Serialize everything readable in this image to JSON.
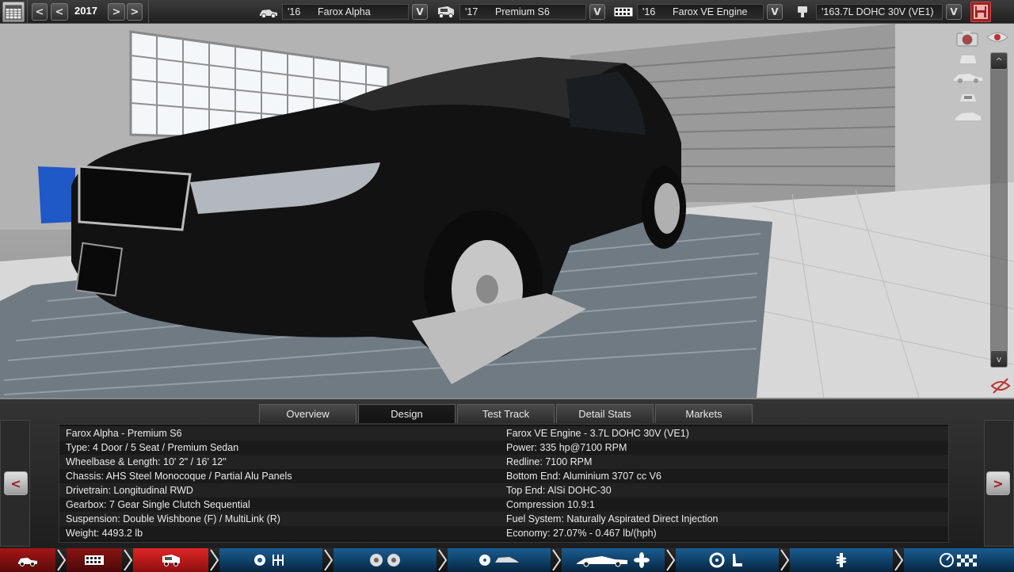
{
  "topbar": {
    "year": "2017",
    "prev_fast": "<",
    "prev": "<",
    "next": ">",
    "next_fast": ">",
    "model": {
      "year": "'16",
      "name": "Farox Alpha",
      "dropdown": "V"
    },
    "trim": {
      "year": "'17",
      "name": "Premium S6",
      "dropdown": "V"
    },
    "engine_family": {
      "year": "'16",
      "name": "Farox VE Engine",
      "dropdown": "V"
    },
    "engine_variant": {
      "name": "'163.7L DOHC 30V (VE1)",
      "dropdown": "V"
    }
  },
  "scene": {
    "scroll_up": "^",
    "scroll_down": "v"
  },
  "tabs": [
    "Overview",
    "Design",
    "Test Track",
    "Detail Stats",
    "Markets"
  ],
  "active_tab": "Design",
  "panel": {
    "prev": "<",
    "next": ">",
    "left_stats": [
      "Farox Alpha - Premium S6",
      "Type: 4 Door / 5 Seat / Premium Sedan",
      "Wheelbase & Length: 10' 2\" / 16' 12\"",
      "Chassis: AHS Steel Monocoque / Partial Alu Panels",
      "Drivetrain: Longitudinal RWD",
      "Gearbox: 7 Gear Single Clutch Sequential",
      "Suspension: Double Wishbone (F) / MultiLink (R)",
      "Weight: 4493.2 lb"
    ],
    "right_stats": [
      "Farox VE Engine - 3.7L DOHC 30V (VE1)",
      "Power: 335 hp@7100 RPM",
      "Redline: 7100 RPM",
      "Bottom End: Aluminium 3707 cc V6",
      "Top End: AlSi DOHC-30",
      "Compression 10.9:1",
      "Fuel System: Naturally Aspirated Direct Injection",
      "Economy: 27.07% - 0.467 lb/(hph)"
    ]
  },
  "nav_steps": [
    {
      "icon": "car-model-icon",
      "color": "#8a1010"
    },
    {
      "icon": "chassis-icon",
      "color": "#8a1010"
    },
    {
      "icon": "trim-icon",
      "color": "#c01a1a"
    },
    {
      "icon": "engine-gearbox-icon",
      "color": "#0d3c63"
    },
    {
      "icon": "wheels-icon",
      "color": "#0d3c63"
    },
    {
      "icon": "fixtures-icon",
      "color": "#0d3c63"
    },
    {
      "icon": "body-aero-icon",
      "color": "#0d3c63"
    },
    {
      "icon": "interior-icon",
      "color": "#0d3c63"
    },
    {
      "icon": "suspension-icon",
      "color": "#0d3c63"
    },
    {
      "icon": "test-finish-icon",
      "color": "#0d3c63"
    }
  ]
}
